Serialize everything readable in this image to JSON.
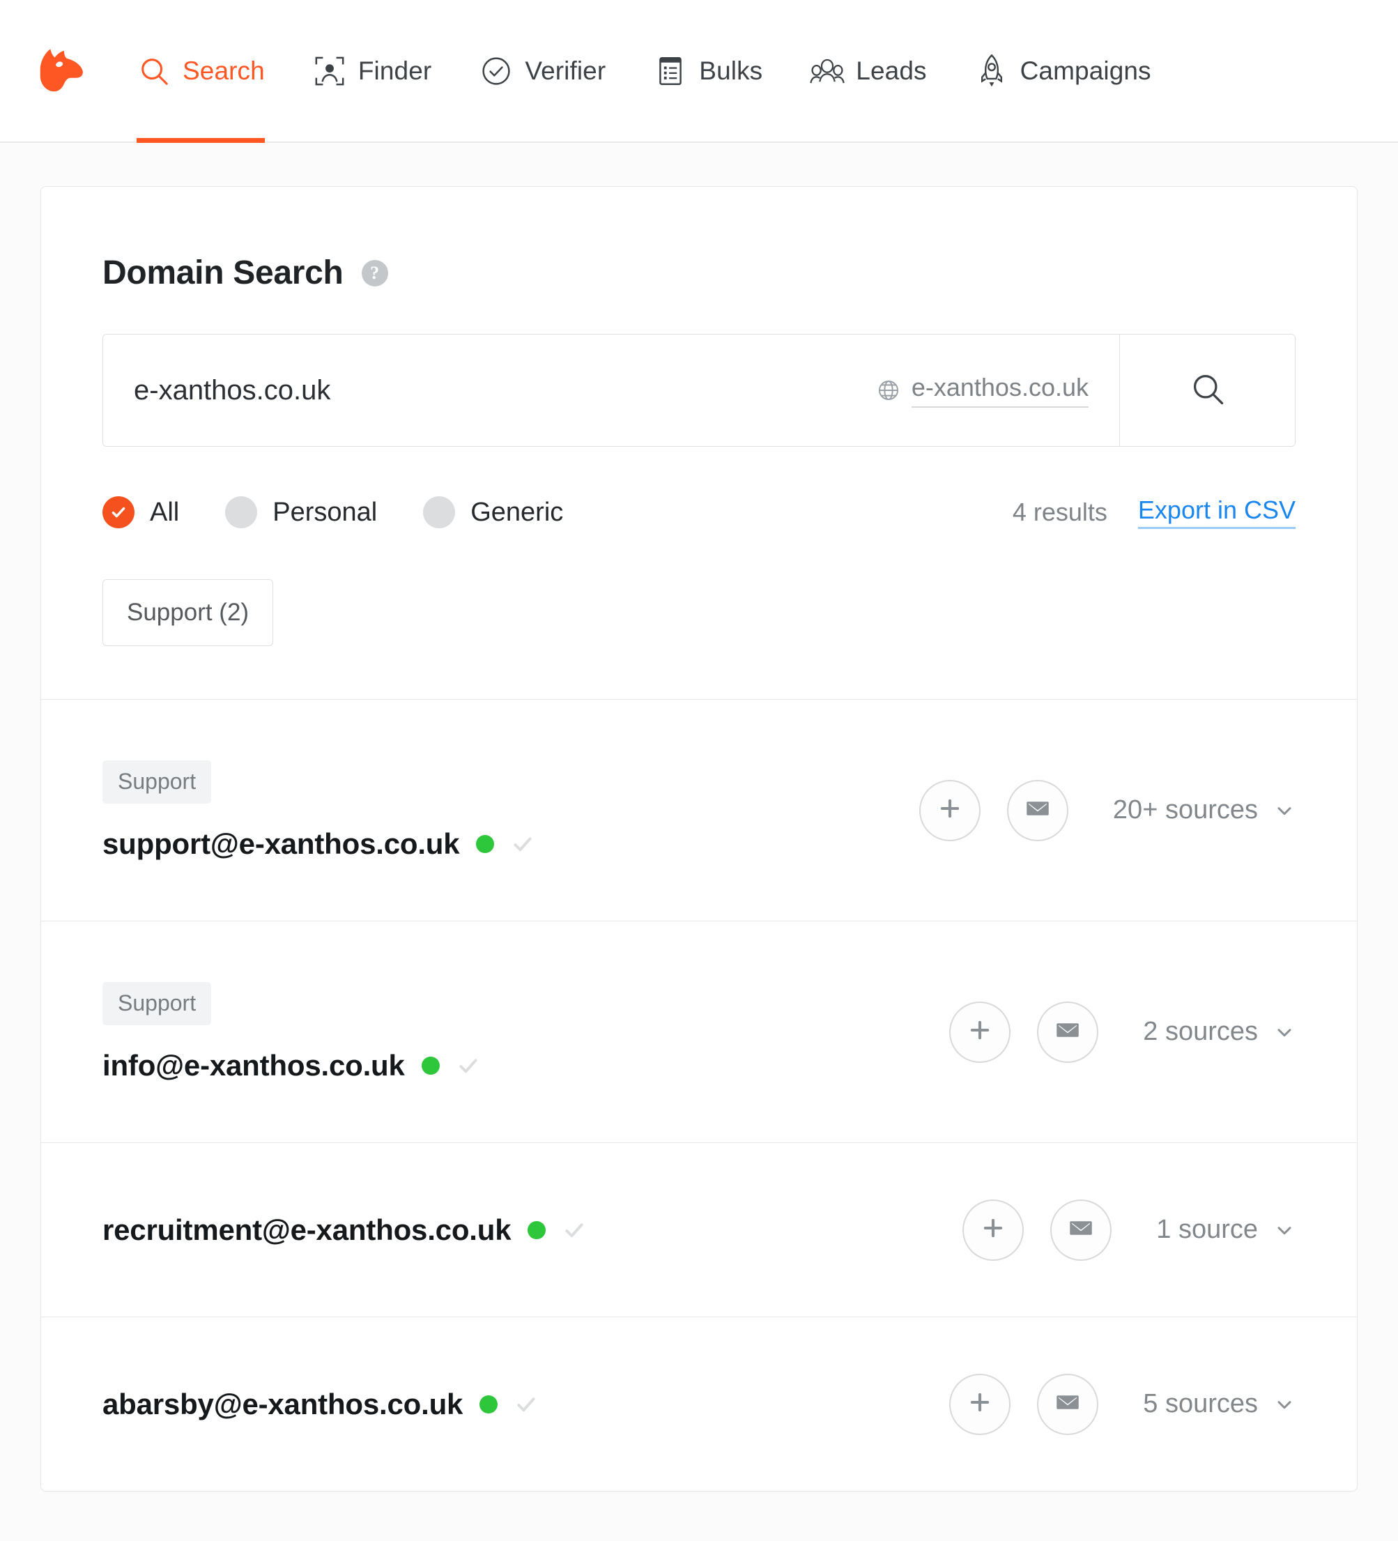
{
  "brand": {
    "color": "#ff5724",
    "logo_icon": "hunter-fox-logo"
  },
  "nav": {
    "items": [
      {
        "label": "Search",
        "icon": "search-icon",
        "active": true
      },
      {
        "label": "Finder",
        "icon": "person-frame-icon",
        "active": false
      },
      {
        "label": "Verifier",
        "icon": "check-circle-icon",
        "active": false
      },
      {
        "label": "Bulks",
        "icon": "list-document-icon",
        "active": false
      },
      {
        "label": "Leads",
        "icon": "people-group-icon",
        "active": false
      },
      {
        "label": "Campaigns",
        "icon": "rocket-icon",
        "active": false
      }
    ]
  },
  "panel": {
    "title": "Domain Search",
    "help_icon": "question-mark-icon",
    "search": {
      "value": "e-xanthos.co.uk",
      "placeholder": "e-xanthos.co.uk",
      "domain_chip": {
        "icon": "globe-icon",
        "text": "e-xanthos.co.uk"
      },
      "submit_icon": "search-icon"
    },
    "filters": [
      {
        "label": "All",
        "selected": true
      },
      {
        "label": "Personal",
        "selected": false
      },
      {
        "label": "Generic",
        "selected": false
      }
    ],
    "results_count": "4 results",
    "export_label": "Export in CSV",
    "departments": [
      {
        "label": "Support (2)"
      }
    ],
    "results": [
      {
        "department": "Support",
        "email": "support@e-xanthos.co.uk",
        "status_color": "#2ec63b",
        "verified_icon": "check-icon",
        "add_icon": "plus-icon",
        "mail_icon": "envelope-icon",
        "sources": "20+ sources",
        "chevron_icon": "chevron-down-icon"
      },
      {
        "department": "Support",
        "email": "info@e-xanthos.co.uk",
        "status_color": "#2ec63b",
        "verified_icon": "check-icon",
        "add_icon": "plus-icon",
        "mail_icon": "envelope-icon",
        "sources": "2 sources",
        "chevron_icon": "chevron-down-icon"
      },
      {
        "department": "",
        "email": "recruitment@e-xanthos.co.uk",
        "status_color": "#2ec63b",
        "verified_icon": "check-icon",
        "add_icon": "plus-icon",
        "mail_icon": "envelope-icon",
        "sources": "1 source",
        "chevron_icon": "chevron-down-icon"
      },
      {
        "department": "",
        "email": "abarsby@e-xanthos.co.uk",
        "status_color": "#2ec63b",
        "verified_icon": "check-icon",
        "add_icon": "plus-icon",
        "mail_icon": "envelope-icon",
        "sources": "5 sources",
        "chevron_icon": "chevron-down-icon"
      }
    ]
  }
}
